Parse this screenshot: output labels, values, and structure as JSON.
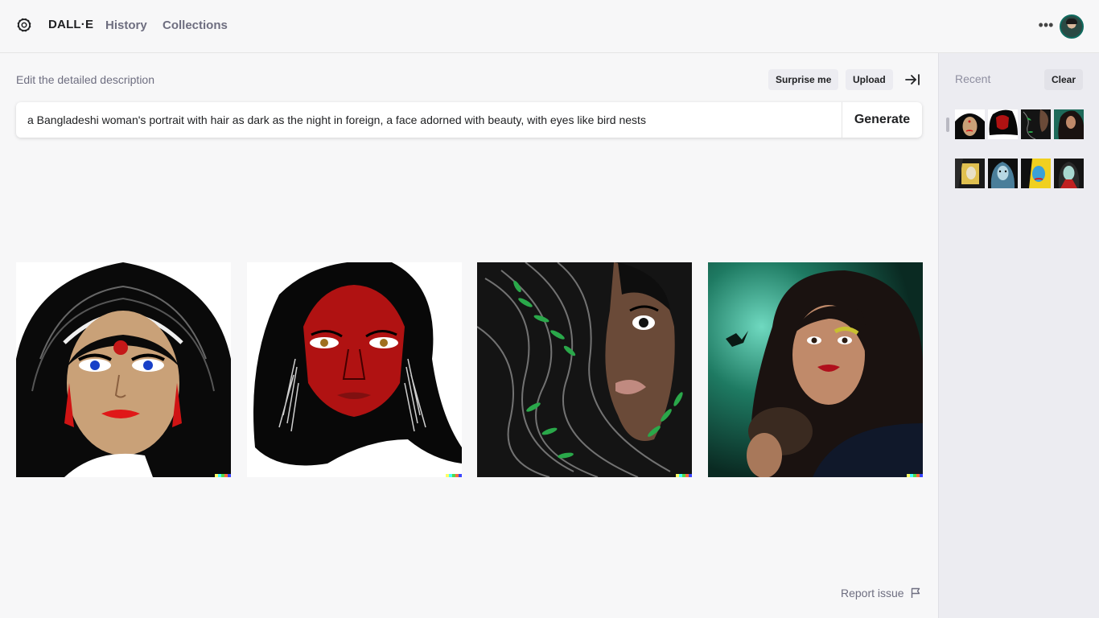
{
  "header": {
    "brand": "DALL·E",
    "nav": [
      {
        "label": "History"
      },
      {
        "label": "Collections"
      }
    ],
    "more_icon": "ellipsis-icon",
    "avatar": "user-avatar"
  },
  "main": {
    "edit_label": "Edit the detailed description",
    "surprise_label": "Surprise me",
    "upload_label": "Upload",
    "collapse_icon": "arrow-to-right-icon",
    "prompt_value": "a Bangladeshi woman's portrait with hair as dark as the night in foreign, a face adorned with beauty, with eyes like bird nests",
    "generate_label": "Generate",
    "images": [
      {
        "id": "result-1",
        "style": "illustration-bindi-headband"
      },
      {
        "id": "result-2",
        "style": "red-face-black-hair"
      },
      {
        "id": "result-3",
        "style": "hair-with-green-leaves"
      },
      {
        "id": "result-4",
        "style": "photo-teal-bird"
      }
    ],
    "report_label": "Report issue",
    "report_icon": "flag-icon"
  },
  "sidebar": {
    "recent_label": "Recent",
    "clear_label": "Clear",
    "thumb_count": 8
  },
  "colors": {
    "background": "#f7f7f8",
    "sidebar": "#ececf1",
    "pill": "#ececf1",
    "text": "#202123",
    "muted": "#6e6e80"
  }
}
